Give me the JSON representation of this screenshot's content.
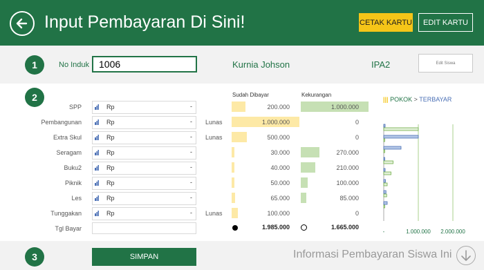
{
  "header": {
    "title": "Input Pembayaran Di Sini!",
    "cetak_label": "CETAK KARTU",
    "edit_label": "EDIT KARTU"
  },
  "steps": [
    "1",
    "2",
    "3"
  ],
  "student": {
    "no_induk_label": "No Induk",
    "no_induk_value": "1006",
    "name": "Kurnia Johson",
    "class": "IPA2",
    "edit_siswa_label": "Edit Siswa"
  },
  "columns": {
    "sudah_dibayar": "Sudah Dibayar",
    "kekurangan": "Kekurangan"
  },
  "currency": "Rp",
  "empty_amount": "-",
  "rows": [
    {
      "label": "SPP",
      "status": "",
      "paid": "200.000",
      "remaining": "1.000.000"
    },
    {
      "label": "Pembangunan",
      "status": "Lunas",
      "paid": "1.000.000",
      "remaining": "0"
    },
    {
      "label": "Extra Skul",
      "status": "Lunas",
      "paid": "500.000",
      "remaining": "0"
    },
    {
      "label": "Seragam",
      "status": "",
      "paid": "30.000",
      "remaining": "270.000"
    },
    {
      "label": "Buku2",
      "status": "",
      "paid": "40.000",
      "remaining": "210.000"
    },
    {
      "label": "Piknik",
      "status": "",
      "paid": "50.000",
      "remaining": "100.000"
    },
    {
      "label": "Les",
      "status": "",
      "paid": "65.000",
      "remaining": "85.000"
    },
    {
      "label": "Tunggakan",
      "status": "Lunas",
      "paid": "100.000",
      "remaining": "0"
    }
  ],
  "tgl_bayar_label": "Tgl Bayar",
  "totals": {
    "paid": "1.985.000",
    "remaining": "1.665.000"
  },
  "colors": {
    "accent": "#217346",
    "yellow": "#f5c518",
    "paid_bar": "#fde9a6",
    "remaining_bar": "#c6e0b4",
    "blue": "#4a6fb5"
  },
  "chart_data": {
    "type": "bar",
    "title": "",
    "legend": [
      {
        "text": "POKOK",
        "color": "#217346"
      },
      {
        "text": ">",
        "color": "#555555"
      },
      {
        "text": "TERBAYAR",
        "color": "#4a6fb5"
      }
    ],
    "legend_mark": "|||",
    "categories": [
      "SPP",
      "Pembangunan",
      "Extra Skul",
      "Seragam",
      "Buku2",
      "Piknik",
      "Les",
      "Tunggakan"
    ],
    "series": [
      {
        "name": "POKOK",
        "values": [
          40000,
          1000000,
          500000,
          30000,
          40000,
          50000,
          65000,
          100000
        ]
      },
      {
        "name": "TERBAYAR",
        "values": [
          1000000,
          0,
          0,
          270000,
          210000,
          100000,
          85000,
          0
        ]
      }
    ],
    "xticks": [
      "-",
      "1.000.000",
      "2.000.000"
    ],
    "xlim": [
      0,
      2000000
    ],
    "grid": true
  },
  "footer": {
    "simpan_label": "SIMPAN",
    "info_text": "Informasi Pembayaran Siswa Ini"
  }
}
